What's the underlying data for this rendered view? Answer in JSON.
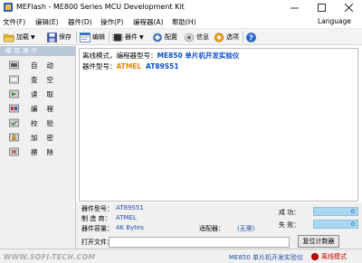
{
  "window": {
    "title": "MEFlash - ME800 Series MCU Development Kit"
  },
  "menu": {
    "items": [
      "文件(F)",
      "编辑(E)",
      "器件(D)",
      "操作(P)",
      "编程器(A)",
      "帮助(H)"
    ],
    "language": "Language"
  },
  "toolbar": {
    "load": "加载",
    "save": "保存",
    "edit": "编辑",
    "device": "器件",
    "config": "配置",
    "info": "信息",
    "options": "选项"
  },
  "sidebar": {
    "header": "编程操作",
    "items": [
      {
        "label": "自动",
        "icon": "auto-icon"
      },
      {
        "label": "查空",
        "icon": "blank-check-icon"
      },
      {
        "label": "读取",
        "icon": "read-icon"
      },
      {
        "label": "编程",
        "icon": "program-icon"
      },
      {
        "label": "校验",
        "icon": "verify-icon"
      },
      {
        "label": "加密",
        "icon": "encrypt-icon"
      },
      {
        "label": "擦除",
        "icon": "erase-icon"
      }
    ]
  },
  "log": {
    "line1_prefix": "离线模式，编程器型号：",
    "line1_value": "ME850 单片机开发实验仪",
    "line2_prefix": "器件型号：",
    "line2_vendor": "ATMEL",
    "line2_model": "AT89S51"
  },
  "info": {
    "device_model_label": "器件型号：",
    "device_model_value": "AT89S51",
    "manufacturer_label": "制 造 商：",
    "manufacturer_value": "ATMEL",
    "capacity_label": "器件容量：",
    "capacity_value": "4K Bytes",
    "adapter_label": "适配器：",
    "adapter_value": "(无需)",
    "open_file_label": "打开文件：",
    "open_file_value": "",
    "success_label": "成 功：",
    "success_count": "0",
    "fail_label": "失 败：",
    "fail_count": "0",
    "reset_button": "复位计数器"
  },
  "status": {
    "watermark": "WWW.SOFI-TECH.COM",
    "programmer_model": "ME850 单片机开发实验仪",
    "mode": "离线模式",
    "mode_color": "#cc0000"
  }
}
